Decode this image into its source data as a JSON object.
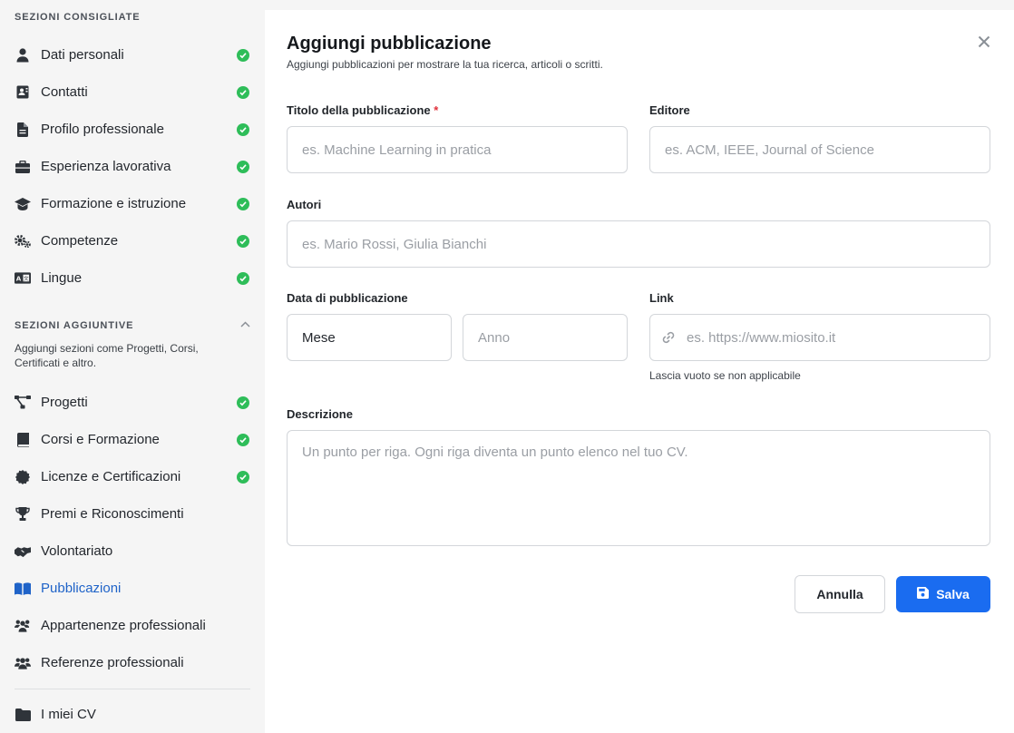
{
  "sidebar": {
    "recommended_heading": "SEZIONI CONSIGLIATE",
    "recommended": [
      {
        "label": "Dati personali",
        "icon": "user-icon",
        "done": true
      },
      {
        "label": "Contatti",
        "icon": "contact-card-icon",
        "done": true
      },
      {
        "label": "Profilo professionale",
        "icon": "document-icon",
        "done": true
      },
      {
        "label": "Esperienza lavorativa",
        "icon": "briefcase-icon",
        "done": true
      },
      {
        "label": "Formazione e istruzione",
        "icon": "graduation-cap-icon",
        "done": true
      },
      {
        "label": "Competenze",
        "icon": "gears-icon",
        "done": true
      },
      {
        "label": "Lingue",
        "icon": "language-icon",
        "done": true
      }
    ],
    "additional_heading": "SEZIONI AGGIUNTIVE",
    "additional_desc": "Aggiungi sezioni come Progetti, Corsi, Certificati e altro.",
    "additional": [
      {
        "label": "Progetti",
        "icon": "project-diagram-icon",
        "done": true
      },
      {
        "label": "Corsi e Formazione",
        "icon": "book-icon",
        "done": true
      },
      {
        "label": "Licenze e Certificazioni",
        "icon": "certificate-icon",
        "done": true
      },
      {
        "label": "Premi e Riconoscimenti",
        "icon": "trophy-icon",
        "done": false
      },
      {
        "label": "Volontariato",
        "icon": "handshake-icon",
        "done": false
      },
      {
        "label": "Pubblicazioni",
        "icon": "open-book-icon",
        "done": false,
        "active": true
      },
      {
        "label": "Appartenenze professionali",
        "icon": "users-icon",
        "done": false
      },
      {
        "label": "Referenze professionali",
        "icon": "people-icon",
        "done": false
      }
    ],
    "my_cvs": {
      "label": "I miei CV",
      "icon": "folder-icon"
    }
  },
  "modal": {
    "title": "Aggiungi pubblicazione",
    "subtitle": "Aggiungi pubblicazioni per mostrare la tua ricerca, articoli o scritti.",
    "fields": {
      "title_label": "Titolo della pubblicazione",
      "title_required": "*",
      "title_placeholder": "es. Machine Learning in pratica",
      "publisher_label": "Editore",
      "publisher_placeholder": "es. ACM, IEEE, Journal of Science",
      "authors_label": "Autori",
      "authors_placeholder": "es. Mario Rossi, Giulia Bianchi",
      "date_label": "Data di pubblicazione",
      "month_value": "Mese",
      "year_placeholder": "Anno",
      "link_label": "Link",
      "link_placeholder": "es. https://www.miosito.it",
      "link_hint": "Lascia vuoto se non applicabile",
      "description_label": "Descrizione",
      "description_placeholder": "Un punto per riga. Ogni riga diventa un punto elenco nel tuo CV."
    },
    "cancel_label": "Annulla",
    "save_label": "Salva"
  },
  "colors": {
    "accent": "#1a6cf0",
    "active_nav": "#1f63c8",
    "check": "#2ebd59",
    "required": "#e0313b"
  }
}
